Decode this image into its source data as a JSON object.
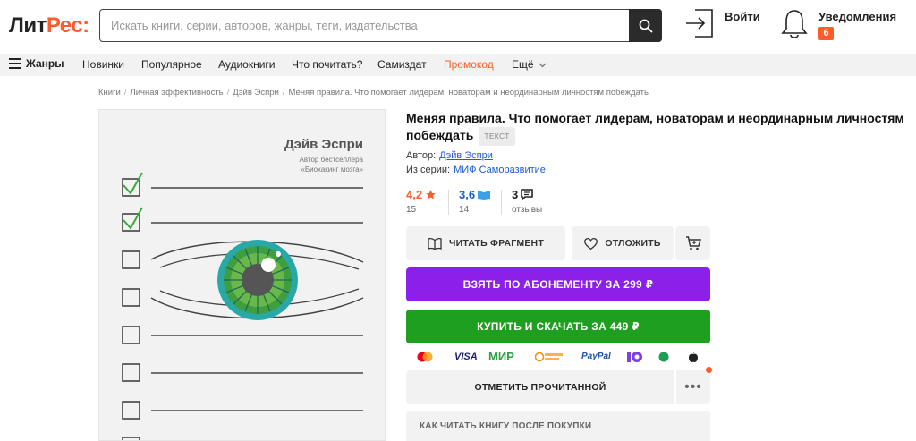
{
  "header": {
    "logo_part1": "Лит",
    "logo_part2": "Рес:",
    "search_placeholder": "Искать книги, серии, авторов, жанры, теги, издательства",
    "login_label": "Войти",
    "notifications_label": "Уведомления",
    "notifications_count": "6"
  },
  "nav": {
    "genres": "Жанры",
    "items": [
      "Новинки",
      "Популярное",
      "Аудиокниги",
      "Что почитать?",
      "Самиздат",
      "Промокод",
      "Ещё"
    ]
  },
  "breadcrumb": [
    "Книги",
    "Личная эффективность",
    "Дэйв Эспри",
    "Меняя правила. Что помогает лидерам, новаторам и неординарным личностям побеждать"
  ],
  "cover": {
    "author": "Дэйв Эспри",
    "subtitle_line1": "Автор бестселлера",
    "subtitle_line2": "«Биохакинг мозга»"
  },
  "book": {
    "title": "Меняя правила. Что помогает лидерам, новаторам и неординарным личностям побеждать",
    "type_badge": "ТЕКСТ",
    "author_label": "Автор:",
    "author": "Дэйв Эспри",
    "series_label": "Из серии:",
    "series": "МИФ Саморазвитие"
  },
  "ratings": {
    "litres_value": "4,2",
    "litres_count": "15",
    "livelib_value": "3,6",
    "livelib_count": "14",
    "reviews_value": "3",
    "reviews_label": "отзывы"
  },
  "actions": {
    "read_fragment": "ЧИТАТЬ ФРАГМЕНТ",
    "postpone": "ОТЛОЖИТЬ",
    "subscribe": "ВЗЯТЬ ПО АБОНЕМЕНТУ ЗА 299 ₽",
    "buy": "КУПИТЬ И СКАЧАТЬ ЗА 449 ₽",
    "mark_read": "ОТМЕТИТЬ ПРОЧИТАННОЙ",
    "more": "•••",
    "how_to_read": "КАК ЧИТАТЬ КНИГУ ПОСЛЕ ПОКУПКИ"
  },
  "payments": [
    "VISA",
    "МИР",
    "PayPal"
  ],
  "colors": {
    "brand": "#ff5c2d",
    "subscribe": "#8c1fe8",
    "buy": "#1f9f1f",
    "link": "#1b5bd6"
  }
}
